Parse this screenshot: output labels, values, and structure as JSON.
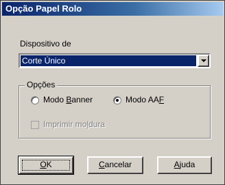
{
  "window": {
    "title": "Opção Papel Rolo"
  },
  "device": {
    "label": "Dispositivo de",
    "selected": "Corte Único"
  },
  "options": {
    "group_label": "Opções",
    "radio_banner": {
      "label_pre": "Modo ",
      "label_key": "B",
      "label_post": "anner",
      "checked": false
    },
    "radio_aaf": {
      "label_pre": "Modo AA",
      "label_key": "F",
      "label_post": "",
      "checked": true
    },
    "checkbox_frame": {
      "label_pre": "Imprimir mo",
      "label_key": "l",
      "label_post": "dura",
      "checked": false,
      "enabled": false
    }
  },
  "buttons": {
    "ok": {
      "key": "O",
      "rest": "K"
    },
    "cancel": {
      "key": "C",
      "rest": "ancelar"
    },
    "help": {
      "key": "A",
      "rest": "juda"
    }
  },
  "colors": {
    "titlebar_start": "#0a246a",
    "titlebar_end": "#a6caf0",
    "face": "#d4d0c8",
    "selection": "#0a246a"
  }
}
